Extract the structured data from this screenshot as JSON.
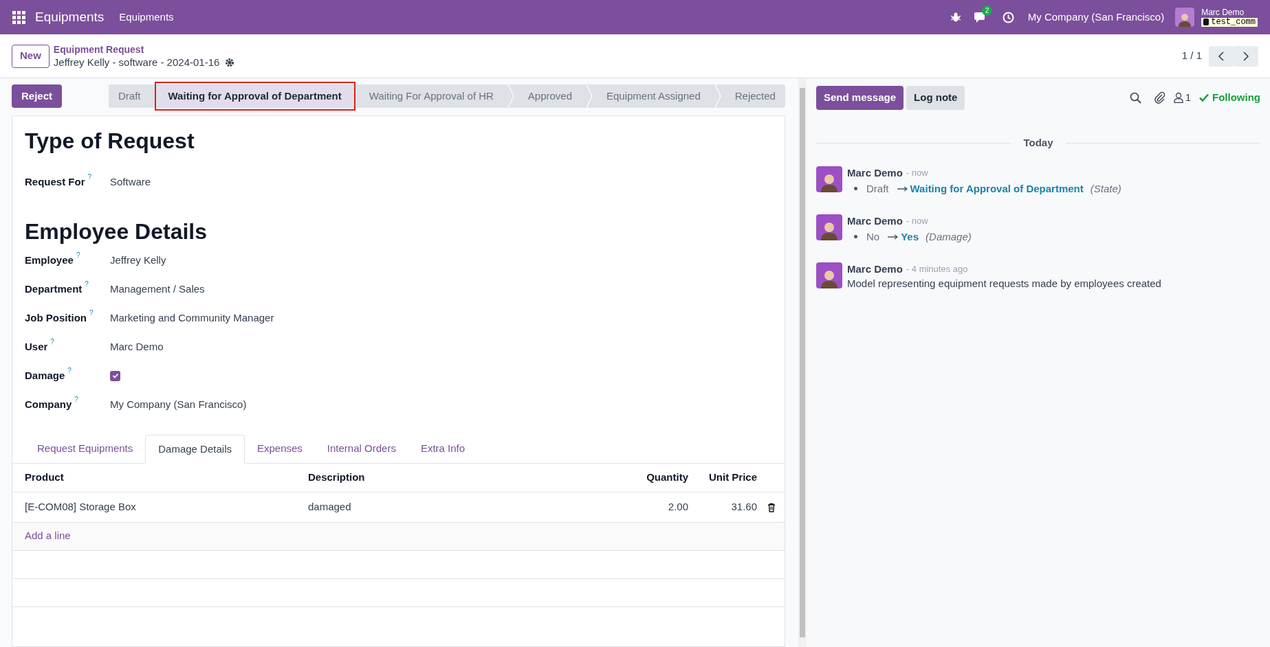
{
  "navbar": {
    "app_name": "Equipments",
    "menu": [
      "Equipments"
    ],
    "chat_badge": "2",
    "company": "My Company (San Francisco)",
    "user_name": "Marc Demo",
    "database": "test_comm"
  },
  "breadcrumb": {
    "parent": "Equipment Request",
    "record": "Jeffrey Kelly - software - 2024-01-16"
  },
  "new_button": "New",
  "pager": "1 / 1",
  "reject_button": "Reject",
  "stages": [
    {
      "label": "Draft",
      "selected": false,
      "highlighted": false
    },
    {
      "label": "Waiting for Approval of Department",
      "selected": true,
      "highlighted": true
    },
    {
      "label": "Waiting For Approval of HR",
      "selected": false,
      "highlighted": false
    },
    {
      "label": "Approved",
      "selected": false,
      "highlighted": false
    },
    {
      "label": "Equipment Assigned",
      "selected": false,
      "highlighted": false
    },
    {
      "label": "Rejected",
      "selected": false,
      "highlighted": false
    }
  ],
  "sections": [
    {
      "title": "Type of Request",
      "fields": [
        {
          "label": "Request For",
          "kind": "text",
          "value": "Software"
        }
      ]
    },
    {
      "title": "Employee Details",
      "fields": [
        {
          "label": "Employee",
          "kind": "text",
          "value": "Jeffrey Kelly"
        },
        {
          "label": "Department",
          "kind": "text",
          "value": "Management / Sales"
        },
        {
          "label": "Job Position",
          "kind": "text",
          "value": "Marketing and Community Manager"
        },
        {
          "label": "User",
          "kind": "text",
          "value": "Marc Demo"
        },
        {
          "label": "Damage",
          "kind": "checkbox",
          "checked": true
        },
        {
          "label": "Company",
          "kind": "text",
          "value": "My Company (San Francisco)"
        }
      ]
    }
  ],
  "help_mark": "?",
  "tabs": [
    {
      "label": "Request Equipments",
      "selected": false
    },
    {
      "label": "Damage Details",
      "selected": true
    },
    {
      "label": "Expenses",
      "selected": false
    },
    {
      "label": "Internal Orders",
      "selected": false
    },
    {
      "label": "Extra Info",
      "selected": false
    }
  ],
  "table": {
    "columns": [
      "Product",
      "Description",
      "Quantity",
      "Unit Price"
    ],
    "rows": [
      [
        "[E-COM08] Storage Box",
        "damaged",
        "2.00",
        "31.60"
      ]
    ],
    "add_line": "Add a line"
  },
  "chatter": {
    "send_message": "Send message",
    "log_note": "Log note",
    "followers_count": "1",
    "follow_label": "Following",
    "date_divider": "Today",
    "messages": [
      {
        "author": "Marc Demo",
        "time": "- now",
        "kind": "tracking",
        "old": "Draft",
        "new": "Waiting for Approval of Department",
        "field": "(State)"
      },
      {
        "author": "Marc Demo",
        "time": "- now",
        "kind": "tracking",
        "old": "No",
        "new": "Yes",
        "field": "(Damage)"
      },
      {
        "author": "Marc Demo",
        "time": "- 4 minutes ago",
        "kind": "note",
        "body": "Model representing equipment requests made by employees created"
      }
    ]
  }
}
